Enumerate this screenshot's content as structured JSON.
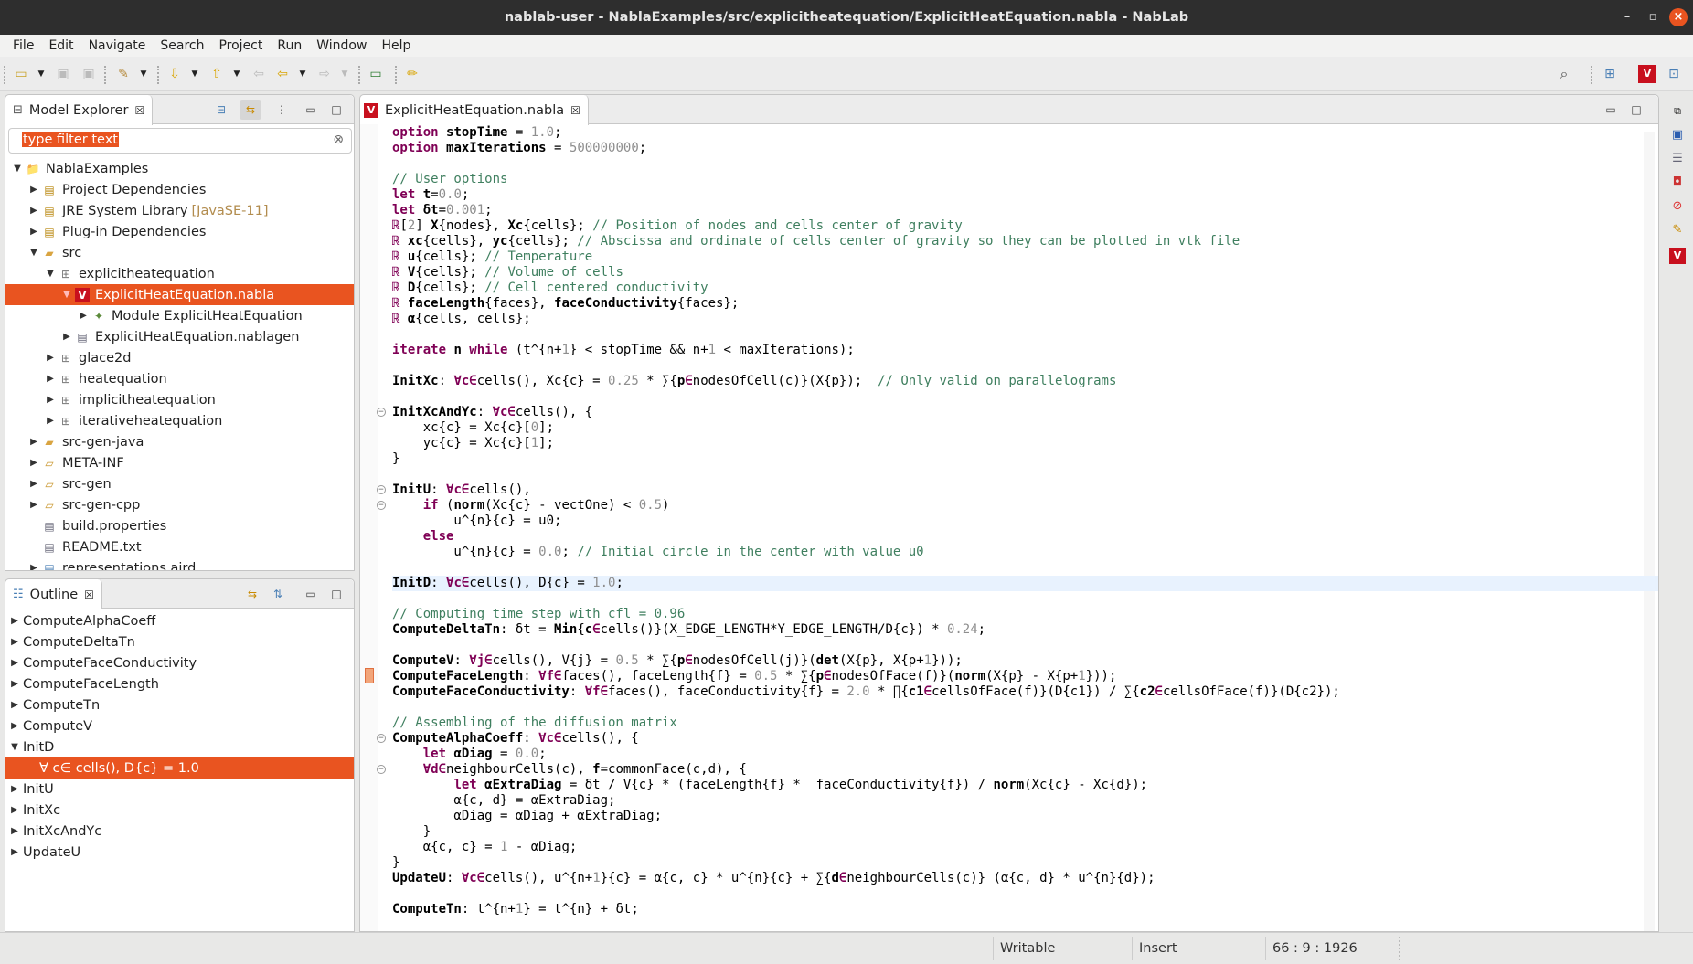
{
  "window": {
    "title": "nablab-user - NablaExamples/src/explicitheatequation/ExplicitHeatEquation.nabla - NabLab",
    "minimize": "–",
    "maximize": "▫",
    "close": "×"
  },
  "menu": [
    "File",
    "Edit",
    "Navigate",
    "Search",
    "Project",
    "Run",
    "Window",
    "Help"
  ],
  "colors": {
    "accent": "#e95420",
    "keyword": "#7f0055",
    "comment": "#3f7f5f",
    "number": "#8e8e8e",
    "current_line": "#e8f2fe",
    "nabla_red": "#c8101e"
  },
  "model_explorer": {
    "title": "Model Explorer",
    "filter_placeholder": "type filter text",
    "items": [
      {
        "label": "NablaExamples",
        "depth": 0,
        "state": "open",
        "icon": "project-icon"
      },
      {
        "label": "Project Dependencies",
        "depth": 1,
        "state": "closed",
        "icon": "library-icon"
      },
      {
        "label": "JRE System Library",
        "suffix": "[JavaSE-11]",
        "depth": 1,
        "state": "closed",
        "icon": "library-icon"
      },
      {
        "label": "Plug-in Dependencies",
        "depth": 1,
        "state": "closed",
        "icon": "library-icon"
      },
      {
        "label": "src",
        "depth": 1,
        "state": "open",
        "icon": "source-folder-icon"
      },
      {
        "label": "explicitheatequation",
        "depth": 2,
        "state": "open",
        "icon": "package-icon"
      },
      {
        "label": "ExplicitHeatEquation.nabla",
        "depth": 3,
        "state": "open",
        "icon": "nabla-file-icon",
        "selected": true
      },
      {
        "label": "Module ExplicitHeatEquation",
        "depth": 4,
        "state": "closed",
        "icon": "module-icon"
      },
      {
        "label": "ExplicitHeatEquation.nablagen",
        "depth": 3,
        "state": "closed",
        "icon": "nablagen-file-icon"
      },
      {
        "label": "glace2d",
        "depth": 2,
        "state": "closed",
        "icon": "package-icon"
      },
      {
        "label": "heatequation",
        "depth": 2,
        "state": "closed",
        "icon": "package-icon"
      },
      {
        "label": "implicitheatequation",
        "depth": 2,
        "state": "closed",
        "icon": "package-icon"
      },
      {
        "label": "iterativeheatequation",
        "depth": 2,
        "state": "closed",
        "icon": "package-icon"
      },
      {
        "label": "src-gen-java",
        "depth": 1,
        "state": "closed",
        "icon": "source-folder-icon"
      },
      {
        "label": "META-INF",
        "depth": 1,
        "state": "closed",
        "icon": "folder-icon"
      },
      {
        "label": "src-gen",
        "depth": 1,
        "state": "closed",
        "icon": "folder-icon"
      },
      {
        "label": "src-gen-cpp",
        "depth": 1,
        "state": "closed",
        "icon": "folder-icon"
      },
      {
        "label": "build.properties",
        "depth": 1,
        "state": "none",
        "icon": "properties-file-icon"
      },
      {
        "label": "README.txt",
        "depth": 1,
        "state": "none",
        "icon": "text-file-icon"
      },
      {
        "label": "representations.aird",
        "depth": 1,
        "state": "closed",
        "icon": "aird-file-icon"
      }
    ]
  },
  "outline": {
    "title": "Outline",
    "items": [
      {
        "label": "ComputeAlphaCoeff",
        "depth": 0,
        "state": "closed"
      },
      {
        "label": "ComputeDeltaTn",
        "depth": 0,
        "state": "closed"
      },
      {
        "label": "ComputeFaceConductivity",
        "depth": 0,
        "state": "closed"
      },
      {
        "label": "ComputeFaceLength",
        "depth": 0,
        "state": "closed"
      },
      {
        "label": "ComputeTn",
        "depth": 0,
        "state": "closed"
      },
      {
        "label": "ComputeV",
        "depth": 0,
        "state": "closed"
      },
      {
        "label": "InitD",
        "depth": 0,
        "state": "open"
      },
      {
        "label": "∀ c∈ cells(), D{c} = 1.0",
        "depth": 1,
        "state": "none",
        "selected": true
      },
      {
        "label": "InitU",
        "depth": 0,
        "state": "closed"
      },
      {
        "label": "InitXc",
        "depth": 0,
        "state": "closed"
      },
      {
        "label": "InitXcAndYc",
        "depth": 0,
        "state": "closed"
      },
      {
        "label": "UpdateU",
        "depth": 0,
        "state": "closed"
      }
    ]
  },
  "editor": {
    "tab_label": "ExplicitHeatEquation.nabla",
    "current_line": 29,
    "fold_lines": [
      18,
      23,
      24,
      39,
      41
    ],
    "lines": [
      [
        [
          "k",
          "option "
        ],
        [
          "b",
          "stopTime"
        ],
        [
          "p",
          " = "
        ],
        [
          "n",
          "1.0"
        ],
        [
          "p",
          ";"
        ]
      ],
      [
        [
          "k",
          "option "
        ],
        [
          "b",
          "maxIterations"
        ],
        [
          "p",
          " = "
        ],
        [
          "n",
          "500000000"
        ],
        [
          "p",
          ";"
        ]
      ],
      [],
      [
        [
          "c",
          "// User options"
        ]
      ],
      [
        [
          "k",
          "let "
        ],
        [
          "b",
          "t"
        ],
        [
          "p",
          "="
        ],
        [
          "n",
          "0.0"
        ],
        [
          "p",
          ";"
        ]
      ],
      [
        [
          "k",
          "let "
        ],
        [
          "b",
          "δt"
        ],
        [
          "p",
          "="
        ],
        [
          "n",
          "0.001"
        ],
        [
          "p",
          ";"
        ]
      ],
      [
        [
          "k",
          "ℝ"
        ],
        [
          "p",
          "["
        ],
        [
          "n",
          "2"
        ],
        [
          "p",
          "] "
        ],
        [
          "b",
          "X"
        ],
        [
          "p",
          "{nodes}, "
        ],
        [
          "b",
          "Xc"
        ],
        [
          "p",
          "{cells}; "
        ],
        [
          "c",
          "// Position of nodes and cells center of gravity"
        ]
      ],
      [
        [
          "k",
          "ℝ "
        ],
        [
          "b",
          "xc"
        ],
        [
          "p",
          "{cells}, "
        ],
        [
          "b",
          "yc"
        ],
        [
          "p",
          "{cells}; "
        ],
        [
          "c",
          "// Abscissa and ordinate of cells center of gravity so they can be plotted in vtk file"
        ]
      ],
      [
        [
          "k",
          "ℝ "
        ],
        [
          "b",
          "u"
        ],
        [
          "p",
          "{cells}; "
        ],
        [
          "c",
          "// Temperature"
        ]
      ],
      [
        [
          "k",
          "ℝ "
        ],
        [
          "b",
          "V"
        ],
        [
          "p",
          "{cells}; "
        ],
        [
          "c",
          "// Volume of cells"
        ]
      ],
      [
        [
          "k",
          "ℝ "
        ],
        [
          "b",
          "D"
        ],
        [
          "p",
          "{cells}; "
        ],
        [
          "c",
          "// Cell centered conductivity"
        ]
      ],
      [
        [
          "k",
          "ℝ "
        ],
        [
          "b",
          "faceLength"
        ],
        [
          "p",
          "{faces}, "
        ],
        [
          "b",
          "faceConductivity"
        ],
        [
          "p",
          "{faces};"
        ]
      ],
      [
        [
          "k",
          "ℝ "
        ],
        [
          "b",
          "α"
        ],
        [
          "p",
          "{cells, cells};"
        ]
      ],
      [],
      [
        [
          "k",
          "iterate "
        ],
        [
          "b",
          "n"
        ],
        [
          "k",
          " while "
        ],
        [
          "p",
          "(t^{n+"
        ],
        [
          "n",
          "1"
        ],
        [
          "p",
          "} < stopTime && n+"
        ],
        [
          "n",
          "1"
        ],
        [
          "p",
          " < maxIterations);"
        ]
      ],
      [],
      [
        [
          "b",
          "InitXc"
        ],
        [
          "p",
          ": "
        ],
        [
          "k",
          "∀c∈"
        ],
        [
          "p",
          "cells(), Xc{c} = "
        ],
        [
          "n",
          "0.25"
        ],
        [
          "p",
          " * ∑{"
        ],
        [
          "b",
          "p"
        ],
        [
          "k",
          "∈"
        ],
        [
          "p",
          "nodesOfCell(c)}(X{p});  "
        ],
        [
          "c",
          "// Only valid on parallelograms"
        ]
      ],
      [],
      [
        [
          "b",
          "InitXcAndYc"
        ],
        [
          "p",
          ": "
        ],
        [
          "k",
          "∀c∈"
        ],
        [
          "p",
          "cells(), {"
        ]
      ],
      [
        [
          "p",
          "    xc{c} = Xc{c}["
        ],
        [
          "n",
          "0"
        ],
        [
          "p",
          "];"
        ]
      ],
      [
        [
          "p",
          "    yc{c} = Xc{c}["
        ],
        [
          "n",
          "1"
        ],
        [
          "p",
          "];"
        ]
      ],
      [
        [
          "p",
          "}"
        ]
      ],
      [],
      [
        [
          "b",
          "InitU"
        ],
        [
          "p",
          ": "
        ],
        [
          "k",
          "∀c∈"
        ],
        [
          "p",
          "cells(),"
        ]
      ],
      [
        [
          "p",
          "    "
        ],
        [
          "k",
          "if "
        ],
        [
          "p",
          "("
        ],
        [
          "b",
          "norm"
        ],
        [
          "p",
          "(Xc{c} - vectOne) < "
        ],
        [
          "n",
          "0.5"
        ],
        [
          "p",
          ")"
        ]
      ],
      [
        [
          "p",
          "        u^{n}{c} = u0;"
        ]
      ],
      [
        [
          "p",
          "    "
        ],
        [
          "k",
          "else"
        ]
      ],
      [
        [
          "p",
          "        u^{n}{c} = "
        ],
        [
          "n",
          "0.0"
        ],
        [
          "p",
          "; "
        ],
        [
          "c",
          "// Initial circle in the center with value u0"
        ]
      ],
      [],
      [
        [
          "b",
          "InitD"
        ],
        [
          "p",
          ": "
        ],
        [
          "k",
          "∀c∈"
        ],
        [
          "p",
          "cells(), D{c} = "
        ],
        [
          "n",
          "1.0"
        ],
        [
          "p",
          ";"
        ]
      ],
      [],
      [
        [
          "c",
          "// Computing time step with cfl = 0.96"
        ]
      ],
      [
        [
          "b",
          "ComputeDeltaTn"
        ],
        [
          "p",
          ": δt = "
        ],
        [
          "b",
          "Min"
        ],
        [
          "p",
          "{"
        ],
        [
          "b",
          "c"
        ],
        [
          "k",
          "∈"
        ],
        [
          "p",
          "cells()}(X_EDGE_LENGTH*Y_EDGE_LENGTH/D{c}) * "
        ],
        [
          "n",
          "0.24"
        ],
        [
          "p",
          ";"
        ]
      ],
      [],
      [
        [
          "b",
          "ComputeV"
        ],
        [
          "p",
          ": "
        ],
        [
          "k",
          "∀j∈"
        ],
        [
          "p",
          "cells(), V{j} = "
        ],
        [
          "n",
          "0.5"
        ],
        [
          "p",
          " * ∑{"
        ],
        [
          "b",
          "p"
        ],
        [
          "k",
          "∈"
        ],
        [
          "p",
          "nodesOfCell(j)}("
        ],
        [
          "b",
          "det"
        ],
        [
          "p",
          "(X{p}, X{p+"
        ],
        [
          "n",
          "1"
        ],
        [
          "p",
          "}));"
        ]
      ],
      [
        [
          "b",
          "ComputeFaceLength"
        ],
        [
          "p",
          ": "
        ],
        [
          "k",
          "∀f∈"
        ],
        [
          "p",
          "faces(), faceLength{f} = "
        ],
        [
          "n",
          "0.5"
        ],
        [
          "p",
          " * ∑{"
        ],
        [
          "b",
          "p"
        ],
        [
          "k",
          "∈"
        ],
        [
          "p",
          "nodesOfFace(f)}("
        ],
        [
          "b",
          "norm"
        ],
        [
          "p",
          "(X{p} - X{p+"
        ],
        [
          "n",
          "1"
        ],
        [
          "p",
          "}));"
        ]
      ],
      [
        [
          "b",
          "ComputeFaceConductivity"
        ],
        [
          "p",
          ": "
        ],
        [
          "k",
          "∀f∈"
        ],
        [
          "p",
          "faces(), faceConductivity{f} = "
        ],
        [
          "n",
          "2.0"
        ],
        [
          "p",
          " * ∏{"
        ],
        [
          "b",
          "c1"
        ],
        [
          "k",
          "∈"
        ],
        [
          "p",
          "cellsOfFace(f)}(D{c1}) / ∑{"
        ],
        [
          "b",
          "c2"
        ],
        [
          "k",
          "∈"
        ],
        [
          "p",
          "cellsOfFace(f)}(D{c2});"
        ]
      ],
      [],
      [
        [
          "c",
          "// Assembling of the diffusion matrix"
        ]
      ],
      [
        [
          "b",
          "ComputeAlphaCoeff"
        ],
        [
          "p",
          ": "
        ],
        [
          "k",
          "∀c∈"
        ],
        [
          "p",
          "cells(), {"
        ]
      ],
      [
        [
          "p",
          "    "
        ],
        [
          "k",
          "let "
        ],
        [
          "b",
          "αDiag"
        ],
        [
          "p",
          " = "
        ],
        [
          "n",
          "0.0"
        ],
        [
          "p",
          ";"
        ]
      ],
      [
        [
          "p",
          "    "
        ],
        [
          "k",
          "∀d∈"
        ],
        [
          "p",
          "neighbourCells(c), "
        ],
        [
          "b",
          "f"
        ],
        [
          "p",
          "=commonFace(c,d), {"
        ]
      ],
      [
        [
          "p",
          "        "
        ],
        [
          "k",
          "let "
        ],
        [
          "b",
          "αExtraDiag"
        ],
        [
          "p",
          " = δt / V{c} * (faceLength{f} *  faceConductivity{f}) / "
        ],
        [
          "b",
          "norm"
        ],
        [
          "p",
          "(Xc{c} - Xc{d});"
        ]
      ],
      [
        [
          "p",
          "        α{c, d} = αExtraDiag;"
        ]
      ],
      [
        [
          "p",
          "        αDiag = αDiag + αExtraDiag;"
        ]
      ],
      [
        [
          "p",
          "    }"
        ]
      ],
      [
        [
          "p",
          "    α{c, c} = "
        ],
        [
          "n",
          "1"
        ],
        [
          "p",
          " - αDiag;"
        ]
      ],
      [
        [
          "p",
          "}"
        ]
      ],
      [
        [
          "b",
          "UpdateU"
        ],
        [
          "p",
          ": "
        ],
        [
          "k",
          "∀c∈"
        ],
        [
          "p",
          "cells(), u^{n+"
        ],
        [
          "n",
          "1"
        ],
        [
          "p",
          "}{c} = α{c, c} * u^{n}{c} + ∑{"
        ],
        [
          "b",
          "d"
        ],
        [
          "k",
          "∈"
        ],
        [
          "p",
          "neighbourCells(c)} (α{c, d} * u^{n}{d});"
        ]
      ],
      [],
      [
        [
          "b",
          "ComputeTn"
        ],
        [
          "p",
          ": t^{n+"
        ],
        [
          "n",
          "1"
        ],
        [
          "p",
          "} = t^{n} + δt;"
        ]
      ]
    ]
  },
  "status": {
    "mode": "Writable",
    "insert": "Insert",
    "position": "66 : 9 : 1926"
  }
}
